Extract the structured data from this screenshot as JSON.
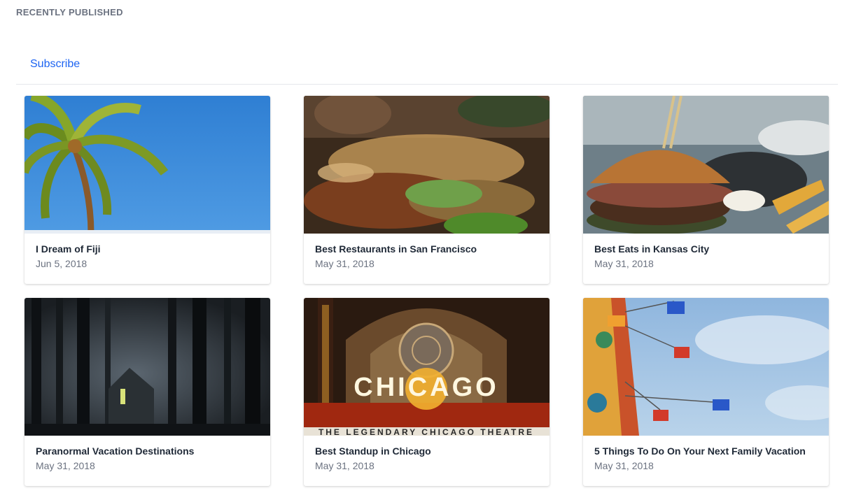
{
  "section": {
    "title": "RECENTLY PUBLISHED",
    "subscribe_label": "Subscribe"
  },
  "posts": [
    {
      "title": "I Dream of Fiji",
      "date": "Jun 5, 2018",
      "image_icon": "palm-tree-photo"
    },
    {
      "title": "Best Restaurants in San Francisco",
      "date": "May 31, 2018",
      "image_icon": "restaurant-food-photo"
    },
    {
      "title": "Best Eats in Kansas City",
      "date": "May 31, 2018",
      "image_icon": "burger-photo"
    },
    {
      "title": "Paranormal Vacation Destinations",
      "date": "May 31, 2018",
      "image_icon": "dark-forest-house-photo"
    },
    {
      "title": "Best Standup in Chicago",
      "date": "May 31, 2018",
      "image_icon": "chicago-theatre-photo",
      "image_sign_text": "CHICAGO",
      "image_banner_text": "THE LEGENDARY CHICAGO THEATRE"
    },
    {
      "title": "5 Things To Do On Your Next Family Vacation",
      "date": "May 31, 2018",
      "image_icon": "swing-carousel-photo"
    }
  ],
  "colors": {
    "accent": "#1d64f2",
    "muted_text": "#6b7280",
    "divider": "#e5e7eb"
  }
}
